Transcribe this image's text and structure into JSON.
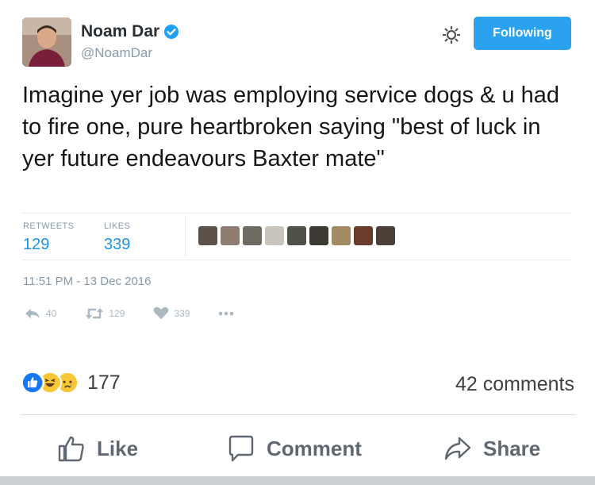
{
  "tweet": {
    "author_name": "Noam Dar",
    "author_handle": "@NoamDar",
    "follow_label": "Following",
    "text": "Imagine yer job was employing service dogs & u had to fire one, pure heartbroken saying \"best of luck in yer future endeavours Baxter mate\"",
    "stats": {
      "retweets_label": "RETWEETS",
      "retweets_value": "129",
      "likes_label": "LIKES",
      "likes_value": "339"
    },
    "timestamp": "11:51 PM - 13 Dec 2016",
    "actions": {
      "reply_count": "40",
      "retweet_count": "129",
      "like_count": "339"
    },
    "icons": [
      "verified-icon",
      "gear-icon",
      "reply-icon",
      "retweet-icon",
      "heart-icon",
      "more-icon"
    ],
    "colors": {
      "accent": "#1b95e0",
      "follow_button": "#2aa2ef"
    }
  },
  "facebook": {
    "reaction_count": "177",
    "reactions": [
      "like",
      "haha",
      "sad"
    ],
    "comments_label": "42 comments",
    "like_label": "Like",
    "comment_label": "Comment",
    "share_label": "Share"
  }
}
